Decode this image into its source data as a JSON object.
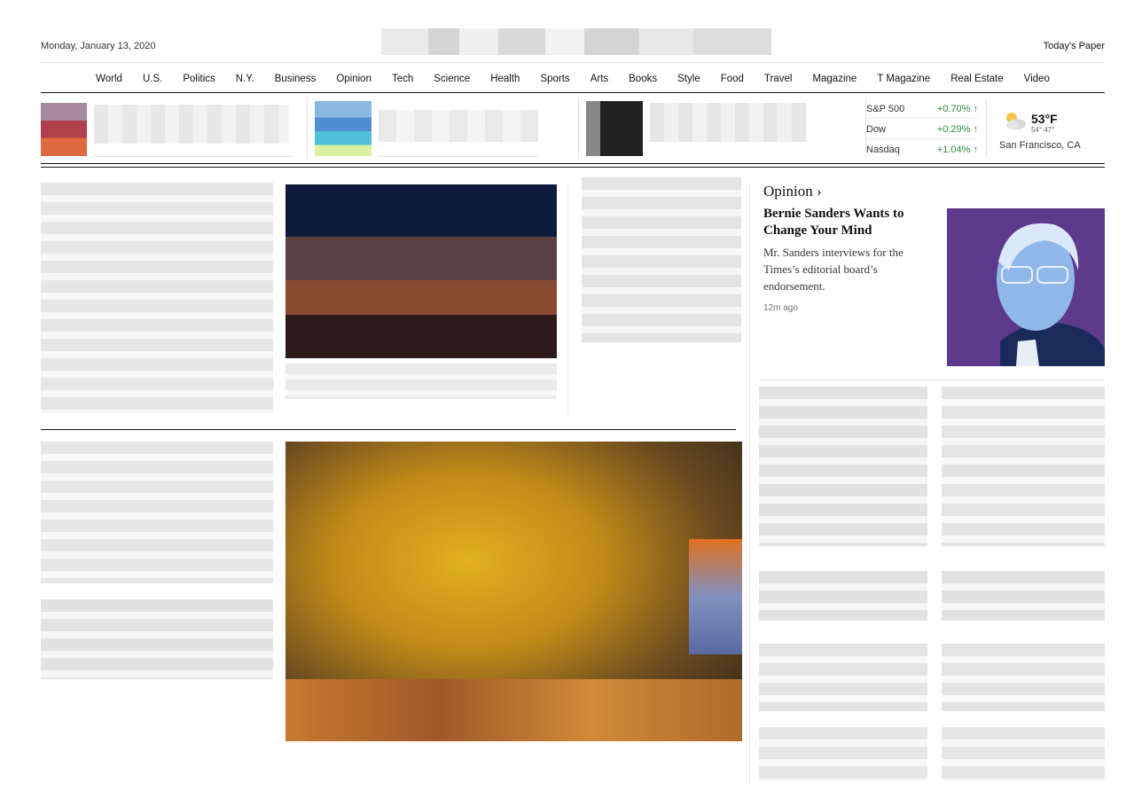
{
  "masthead": {
    "date": "Monday, January 13, 2020",
    "todays_paper": "Today's Paper"
  },
  "nav": [
    "World",
    "U.S.",
    "Politics",
    "N.Y.",
    "Business",
    "Opinion",
    "Tech",
    "Science",
    "Health",
    "Sports",
    "Arts",
    "Books",
    "Style",
    "Food",
    "Travel",
    "Magazine",
    "T Magazine",
    "Real Estate",
    "Video"
  ],
  "markets": [
    {
      "name": "S&P 500",
      "value": "+0.70% ↑"
    },
    {
      "name": "Dow",
      "value": "+0.29% ↑"
    },
    {
      "name": "Nasdaq",
      "value": "+1.04% ↑"
    }
  ],
  "weather": {
    "temp": "53°F",
    "hilo": "54° 47°",
    "city": "San Francisco, CA",
    "icon": "partly-cloudy-icon"
  },
  "opinion": {
    "label": "Opinion ›",
    "headline": "Bernie Sanders Wants to Change Your Mind",
    "summary": "Mr. Sanders interviews for the Times’s editorial board’s endorsement.",
    "time": "12m ago"
  },
  "colors": {
    "market_up": "#2b8a3e",
    "portrait_bg": "#5e3a8c",
    "portrait_figure": "#8fb8e8"
  }
}
